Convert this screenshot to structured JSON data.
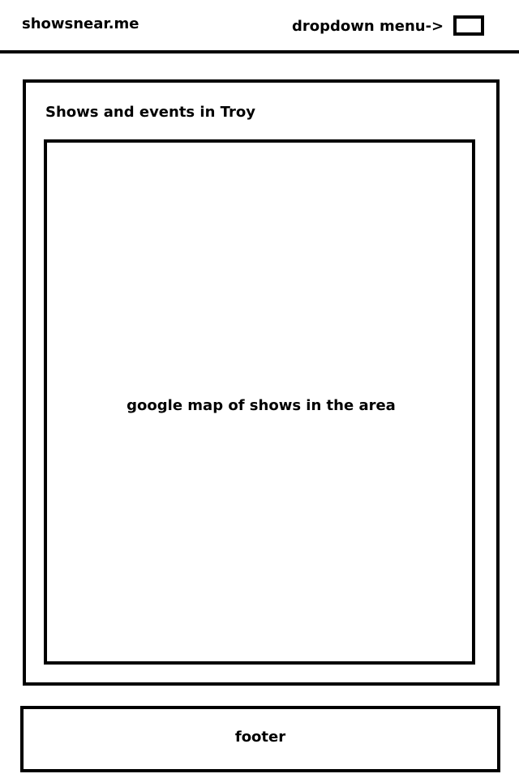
{
  "header": {
    "logo": "showsnear.me",
    "dropdown_label": "dropdown menu->"
  },
  "main": {
    "title": "Shows and events in Troy",
    "map_placeholder": "google map of shows in the area"
  },
  "footer": {
    "label": "footer"
  }
}
